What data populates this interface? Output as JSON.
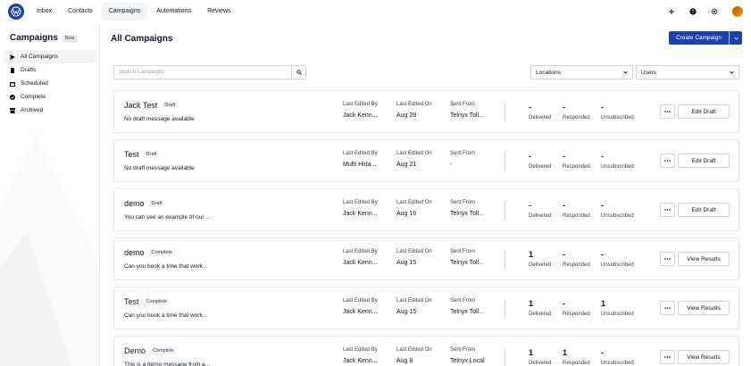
{
  "nav": {
    "links": [
      "Inbox",
      "Contacts",
      "Campaigns",
      "Automations",
      "Reviews"
    ],
    "active": "Campaigns"
  },
  "sidebar": {
    "title": "Campaigns",
    "badge": "Beta",
    "items": [
      {
        "label": "All Campaigns",
        "icon": "send-icon",
        "active": true
      },
      {
        "label": "Drafts",
        "icon": "draft-icon"
      },
      {
        "label": "Scheduled",
        "icon": "calendar-icon"
      },
      {
        "label": "Complete",
        "icon": "check-circle-icon"
      },
      {
        "label": "Archived",
        "icon": "archive-icon"
      }
    ]
  },
  "main": {
    "title": "All Campaigns",
    "create_label": "Create Campaign",
    "search_placeholder": "Search Campaigns",
    "locations_label": "Locations",
    "users_label": "Users"
  },
  "labels": {
    "last_edited_by": "Last Edited By",
    "last_edited_on": "Last Edited On",
    "sent_from": "Sent From",
    "delivered": "Delivered",
    "responded": "Responded",
    "unsubscribed": "Unsubscribed"
  },
  "campaigns": [
    {
      "name": "Jack Test",
      "status": "Draft",
      "message": "No draft message available",
      "edited_by": "Jack Kenn...",
      "edited_on": "Aug 29",
      "sent_from": "Telnyx Toll...",
      "delivered": "-",
      "responded": "-",
      "unsubscribed": "-",
      "action": "Edit Draft"
    },
    {
      "name": "Test",
      "status": "Draft",
      "message": "No draft message available",
      "edited_by": "Mufti Hida...",
      "edited_on": "Aug 21",
      "sent_from": "-",
      "delivered": "-",
      "responded": "-",
      "unsubscribed": "-",
      "action": "Edit Draft"
    },
    {
      "name": "demo",
      "status": "Draft",
      "message": "You can see an example of our ...",
      "edited_by": "Jack Kenn...",
      "edited_on": "Aug 16",
      "sent_from": "Telnyx Toll...",
      "delivered": "-",
      "responded": "-",
      "unsubscribed": "-",
      "action": "Edit Draft"
    },
    {
      "name": "demo",
      "status": "Complete",
      "message": "Can you book a time that work...",
      "edited_by": "Jack Kenn...",
      "edited_on": "Aug 15",
      "sent_from": "Telnyx Toll...",
      "delivered": "1",
      "responded": "-",
      "unsubscribed": "-",
      "action": "View Results"
    },
    {
      "name": "Test",
      "status": "Complete",
      "message": "Can you book a time that work...",
      "edited_by": "Jack Kenn...",
      "edited_on": "Aug 15",
      "sent_from": "Telnyx Toll...",
      "delivered": "1",
      "responded": "-",
      "unsubscribed": "1",
      "action": "View Results"
    },
    {
      "name": "Demo",
      "status": "Complete",
      "message": "This is a demo message from a...",
      "edited_by": "Jack Kenn...",
      "edited_on": "Aug 8",
      "sent_from": "Telnyx Local",
      "delivered": "1",
      "responded": "1",
      "unsubscribed": "-",
      "action": "View Results"
    }
  ],
  "colors": {
    "brand": "#1e40af",
    "border": "#e5e7eb"
  }
}
